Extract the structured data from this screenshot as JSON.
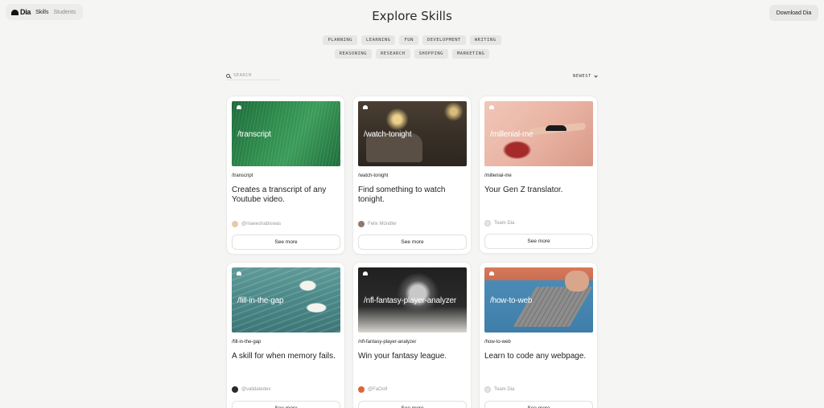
{
  "nav": {
    "logo": "Dia",
    "links": [
      {
        "label": "Skills",
        "active": true
      },
      {
        "label": "Students",
        "active": false
      }
    ],
    "download_label": "Download Dia"
  },
  "page": {
    "title": "Explore Skills"
  },
  "tags": {
    "row1": [
      "PLANNING",
      "LEARNING",
      "FUN",
      "DEVELOPMENT",
      "WRITING"
    ],
    "row2": [
      "REASONING",
      "RESEARCH",
      "SHOPPING",
      "MARKETING"
    ]
  },
  "search": {
    "placeholder": "SEARCH",
    "icon": "search-icon"
  },
  "sort": {
    "value": "NEWEST",
    "icon": "chevron-down-icon"
  },
  "cards": [
    {
      "image_label": "/transcript",
      "slug": "/transcript",
      "description": "Creates a transcript of any Youtube video.",
      "author": "@maeeshabiswas",
      "see_more": "See more"
    },
    {
      "image_label": "/watch-tonight",
      "slug": "/watch-tonight",
      "description": "Find something to watch tonight.",
      "author": "Felix Mündler",
      "see_more": "See more"
    },
    {
      "image_label": "/millenial-me",
      "slug": "/millenial-me",
      "description": "Your Gen Z translator.",
      "author": "Team Dia",
      "see_more": "See more"
    },
    {
      "image_label": "/fill-in-the-gap",
      "slug": "/fill-in-the-gap",
      "description": "A skill for when memory fails.",
      "author": "@validatedev",
      "see_more": "See more"
    },
    {
      "image_label": "/nfl-fantasy-player-analyzer",
      "slug": "/nfl-fantasy-player-analyzer",
      "description": "Win your fantasy league.",
      "author": "@FaOo9",
      "see_more": "See more"
    },
    {
      "image_label": "/how-to-web",
      "slug": "/how-to-web",
      "description": "Learn to code any webpage.",
      "author": "Team Dia",
      "see_more": "See more"
    }
  ],
  "colors": {
    "background": "#f5f5f4",
    "card": "#ffffff",
    "tag_bg": "#e6e6e4"
  }
}
